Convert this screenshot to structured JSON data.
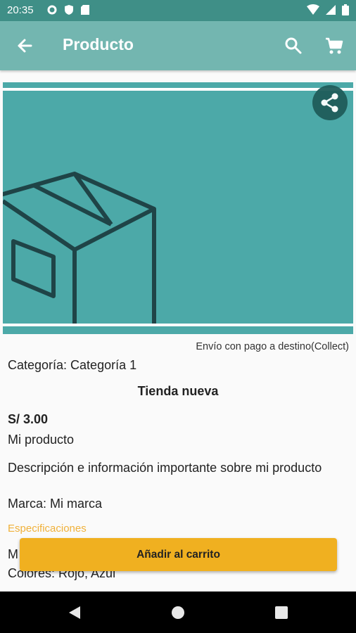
{
  "status_bar": {
    "time": "20:35"
  },
  "app_bar": {
    "title": "Producto"
  },
  "colors": {
    "header": "#73b6b0",
    "status_bar": "#3f8f87",
    "image_bg": "#4ca9a8",
    "accent": "#f0b020",
    "spec_label": "#f0b13a"
  },
  "product": {
    "shipping": "Envío con pago a destino(Collect)",
    "category": "Categoría: Categoría 1",
    "store": "Tienda nueva",
    "price": "S/ 3.00",
    "name": "Mi producto",
    "description": "Descripción e información importante sobre mi producto",
    "brand": "Marca: Mi marca",
    "specs_label": "Especificaciones",
    "spec_line_partial": "M",
    "colors": "Colores: Rojo, Azul"
  },
  "actions": {
    "add_to_cart": "Añadir al carrito"
  },
  "icons": [
    "back-arrow-icon",
    "search-icon",
    "cart-icon",
    "share-icon",
    "box-icon",
    "nav-back-icon",
    "nav-home-icon",
    "nav-recents-icon"
  ]
}
